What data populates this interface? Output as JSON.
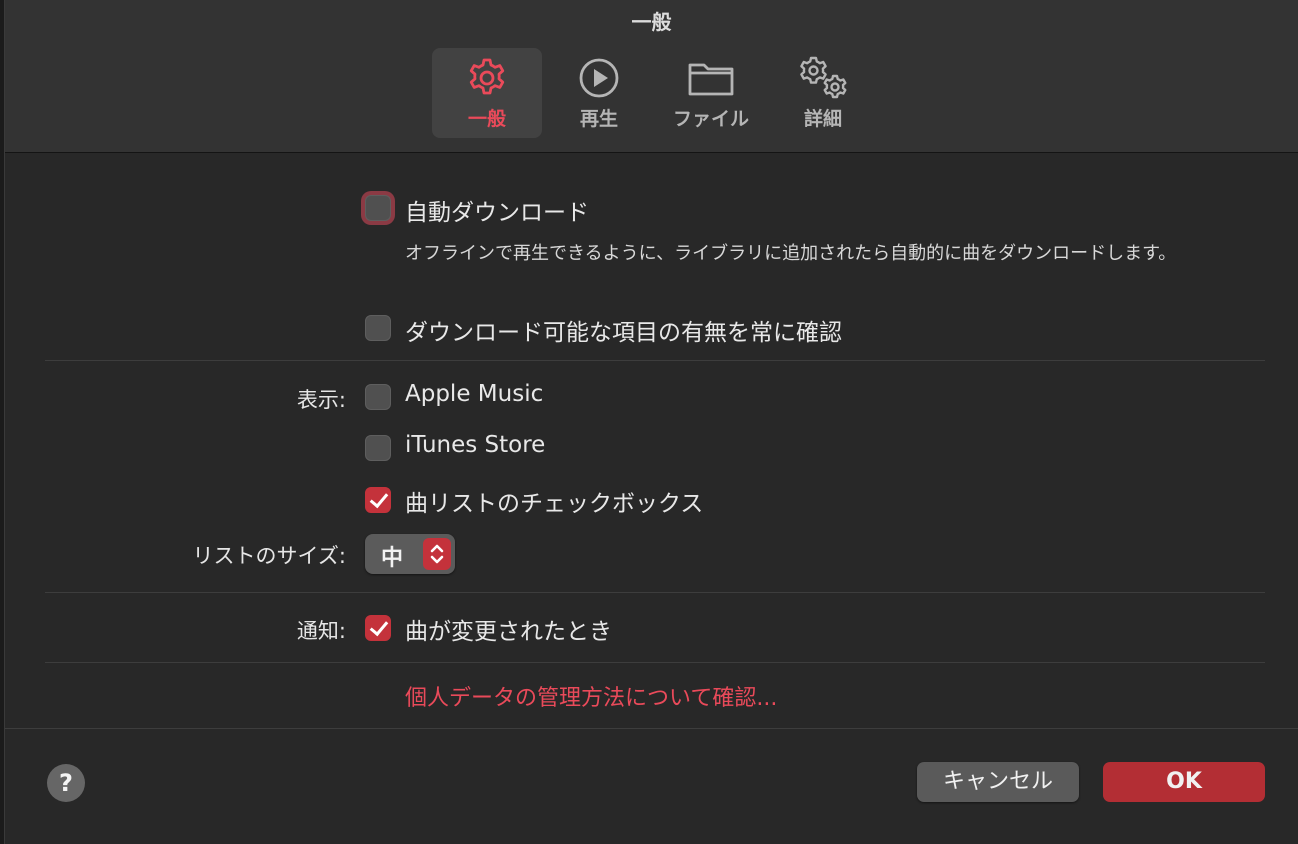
{
  "window": {
    "title": "一般"
  },
  "tabs": [
    {
      "label": "一般",
      "icon": "gear-icon",
      "selected": true
    },
    {
      "label": "再生",
      "icon": "play-circle-icon",
      "selected": false
    },
    {
      "label": "ファイル",
      "icon": "folder-icon",
      "selected": false
    },
    {
      "label": "詳細",
      "icon": "gears-icon",
      "selected": false
    }
  ],
  "download": {
    "auto_label": "自動ダウンロード",
    "auto_checked": false,
    "auto_description": "オフラインで再生できるように、ライブラリに追加されたら自動的に曲をダウンロードします。",
    "check_label": "ダウンロード可能な項目の有無を常に確認",
    "check_checked": false
  },
  "display": {
    "label": "表示:",
    "apple_music_label": "Apple Music",
    "apple_music_checked": false,
    "itunes_store_label": "iTunes Store",
    "itunes_store_checked": false,
    "song_checkbox_label": "曲リストのチェックボックス",
    "song_checkbox_checked": true
  },
  "list_size": {
    "label": "リストのサイズ:",
    "value": "中"
  },
  "notifications": {
    "label": "通知:",
    "song_change_label": "曲が変更されたとき",
    "song_change_checked": true
  },
  "privacy_link": "個人データの管理方法について確認...",
  "footer": {
    "help_label": "?",
    "cancel_label": "キャンセル",
    "ok_label": "OK"
  },
  "colors": {
    "accent": "#c4323b",
    "accent_text": "#ea4a5a",
    "background": "#282828",
    "toolbar": "#333333"
  }
}
